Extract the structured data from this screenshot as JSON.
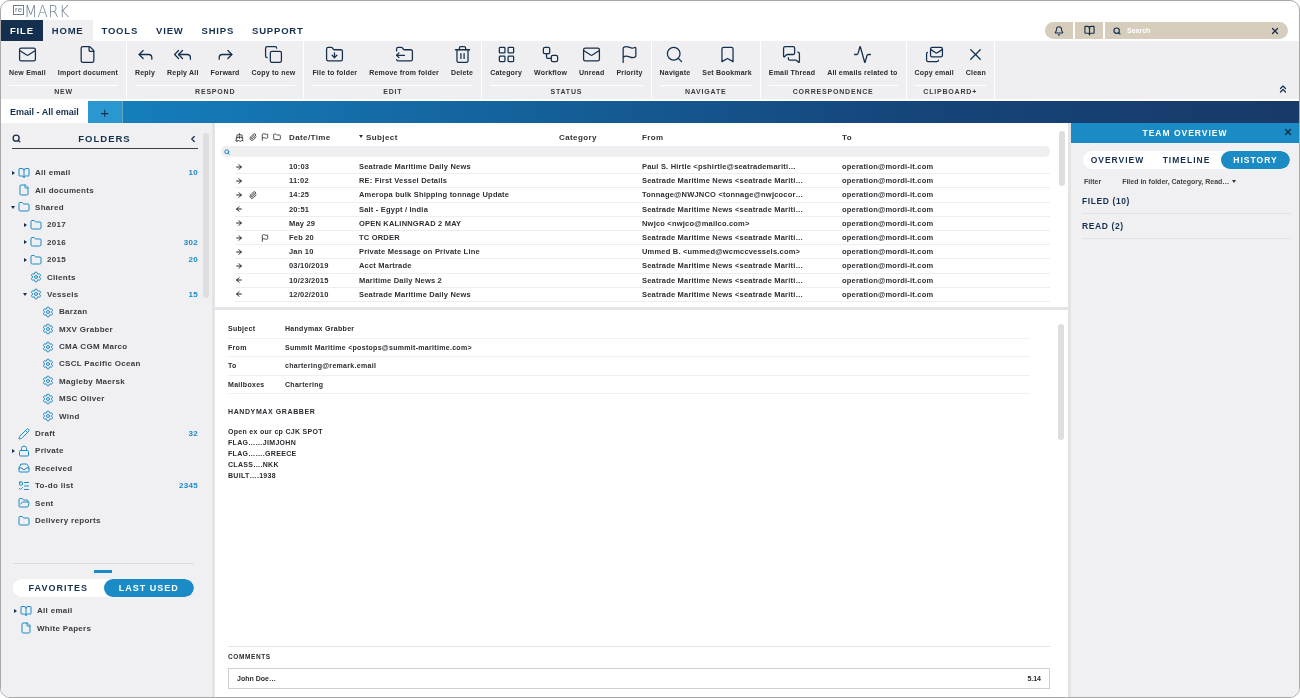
{
  "logo": {
    "prefix": "re",
    "name": "MARK"
  },
  "menu": [
    {
      "label": "FILE",
      "kind": "file",
      "selected": false
    },
    {
      "label": "HOME",
      "kind": "tab",
      "selected": true
    },
    {
      "label": "TOOLS",
      "kind": "tab",
      "selected": false
    },
    {
      "label": "VIEW",
      "kind": "tab",
      "selected": false
    },
    {
      "label": "SHIPS",
      "kind": "tab",
      "selected": false
    },
    {
      "label": "SUPPORT",
      "kind": "tab",
      "selected": false
    }
  ],
  "search": {
    "placeholder": "Search"
  },
  "ribbon": [
    {
      "group": "NEW",
      "buttons": [
        "New Email",
        "Import document"
      ]
    },
    {
      "group": "RESPOND",
      "buttons": [
        "Reply",
        "Reply All",
        "Forward",
        "Copy to new"
      ]
    },
    {
      "group": "EDIT",
      "buttons": [
        "File to folder",
        "Remove from folder",
        "Delete"
      ]
    },
    {
      "group": "STATUS",
      "buttons": [
        "Category",
        "Workflow",
        "Unread",
        "Priority"
      ]
    },
    {
      "group": "NAVIGATE",
      "buttons": [
        "Navigate",
        "Set Bookmark"
      ]
    },
    {
      "group": "CORRESPONDENCE",
      "buttons": [
        "Email Thread",
        "All emails related to"
      ]
    },
    {
      "group": "CLIPBOARD+",
      "buttons": [
        "Copy email",
        "Clean"
      ]
    }
  ],
  "doc_tabs": [
    {
      "label": "Email - All email",
      "selected": true
    }
  ],
  "add_tab": "+",
  "folders": {
    "title": "FOLDERS",
    "items": [
      {
        "label": "All email",
        "kind": "mailbox",
        "expanded": false,
        "count": "10"
      },
      {
        "label": "All documents",
        "kind": "document"
      },
      {
        "label": "Shared",
        "kind": "folder",
        "expanded": true,
        "children": [
          {
            "label": "2017",
            "kind": "folder",
            "expanded": false
          },
          {
            "label": "2016",
            "kind": "folder",
            "expanded": false,
            "count": "302"
          },
          {
            "label": "2015",
            "kind": "folder",
            "expanded": false,
            "count": "20"
          },
          {
            "label": "Clients",
            "kind": "vessel"
          },
          {
            "label": "Vessels",
            "kind": "vessel",
            "expanded": true,
            "count": "15",
            "children": [
              {
                "label": "Barzan",
                "kind": "vessel"
              },
              {
                "label": "MXV Grabber",
                "kind": "vessel"
              },
              {
                "label": "CMA CGM Marco",
                "kind": "vessel"
              },
              {
                "label": "CSCL Pacific Ocean",
                "kind": "vessel"
              },
              {
                "label": "Magleby Maersk",
                "kind": "vessel"
              },
              {
                "label": "MSC Oliver",
                "kind": "vessel"
              },
              {
                "label": "Wind",
                "kind": "vessel"
              }
            ]
          }
        ]
      },
      {
        "label": "Draft",
        "kind": "draft",
        "count": "32"
      },
      {
        "label": "Private",
        "kind": "private",
        "expanded": false
      },
      {
        "label": "Received",
        "kind": "received"
      },
      {
        "label": "To-do list",
        "kind": "todo",
        "count": "2345"
      },
      {
        "label": "Sent",
        "kind": "sent"
      },
      {
        "label": "Delivery reports",
        "kind": "folder"
      }
    ]
  },
  "favorites": {
    "tabs": [
      {
        "label": "FAVORITES",
        "selected": false
      },
      {
        "label": "LAST USED",
        "selected": true
      }
    ],
    "items": [
      {
        "label": "All email",
        "kind": "mailbox",
        "expanded": false
      },
      {
        "label": "White Papers",
        "kind": "document"
      }
    ]
  },
  "table": {
    "columns": [
      {
        "label": "Date/Time",
        "sorted": false
      },
      {
        "label": "Subject",
        "sorted": true
      },
      {
        "label": "Category",
        "sorted": false
      },
      {
        "label": "From",
        "sorted": false
      },
      {
        "label": "To",
        "sorted": false
      }
    ],
    "rows": [
      {
        "kind": "outgoing",
        "attachment": false,
        "flagged": false,
        "date": "10:03",
        "subject": "Seatrade Maritime Daily News",
        "from": "Paul S. Hirtle <pshirtle@seatrademariti…",
        "to": "operation@mordi-it.com"
      },
      {
        "kind": "outgoing",
        "attachment": false,
        "flagged": false,
        "date": "11:02",
        "subject": "RE: First Vessel Details",
        "from": "Seatrade Maritime News <seatrade Mariti…",
        "to": "operation@mordi-it.com"
      },
      {
        "kind": "outgoing",
        "attachment": true,
        "flagged": false,
        "date": "14:25",
        "subject": "Ameropa bulk Shipping tonnage Update",
        "from": "Tonnage@NWJNCO <tonnage@nwjcocor…",
        "to": "operation@mordi-it.com"
      },
      {
        "kind": "incoming",
        "attachment": false,
        "flagged": false,
        "date": "20:51",
        "subject": "Salt - Egypt / India",
        "from": "Seatrade Maritime News <seatrade Mariti…",
        "to": "operation@mordi-it.com"
      },
      {
        "kind": "outgoing",
        "attachment": false,
        "flagged": false,
        "date": "May 29",
        "subject": "OPEN KALINNGRAD 2 MAY",
        "from": "Nwjco <nwjco@mailco.com>",
        "to": "operation@mordi-it.com"
      },
      {
        "kind": "outgoing",
        "attachment": false,
        "flagged": true,
        "date": "Feb 20",
        "subject": "TC ORDER",
        "from": "Seatrade Maritime News <seatrade Mariti…",
        "to": "operation@mordi-it.com"
      },
      {
        "kind": "outgoing",
        "attachment": false,
        "flagged": false,
        "date": "Jan 10",
        "subject": "Private Message on Private Line",
        "from": "Ummed B. <ummed@wcmccvessels.com>",
        "to": "operation@mordi-it.com"
      },
      {
        "kind": "outgoing",
        "attachment": false,
        "flagged": false,
        "date": "03/10/2019",
        "subject": "Acct Martrade",
        "from": "Seatrade Maritime News <seatrade Mariti…",
        "to": "operation@mordi-it.com"
      },
      {
        "kind": "incoming",
        "attachment": false,
        "flagged": false,
        "date": "10/23/2015",
        "subject": "Maritime Daily News 2",
        "from": "Seatrade Maritime News <seatrade Mariti…",
        "to": "operation@mordi-it.com"
      },
      {
        "kind": "incoming",
        "attachment": false,
        "flagged": false,
        "date": "12/02/2010",
        "subject": "Seatrade Maritime Daily News",
        "from": "Seatrade Maritime News <seatrade Mariti…",
        "to": "operation@mordi-it.com"
      }
    ]
  },
  "preview": {
    "fields": [
      {
        "label": "Subject",
        "value": "Handymax Grabber"
      },
      {
        "label": "From",
        "value": "Summit Maritime <postops@summit-maritime.com>"
      },
      {
        "label": "To",
        "value": "chartering@remark.email"
      },
      {
        "label": "Mailboxes",
        "value": "Chartering"
      }
    ],
    "heading": "HANDYMAX GRABBER",
    "body": [
      "Open ex our cp CJK SPOT",
      "FLAG……JIMJOHN",
      "FLAG…….GREECE",
      "CLASS….NKK",
      "BUILT….1938"
    ],
    "comments_title": "COMMENTS",
    "comments": [
      {
        "author": "John Doe…",
        "time": "5.14"
      }
    ]
  },
  "team": {
    "title": "TEAM OVERVIEW",
    "tabs": [
      {
        "label": "OVERVIEW",
        "selected": false
      },
      {
        "label": "TIMELINE",
        "selected": false
      },
      {
        "label": "HISTORY",
        "selected": true
      }
    ],
    "filter_label": "Filter",
    "filter_value": "Filed in folder, Category, Read…",
    "sections": [
      "FILED (10)",
      "READ (2)"
    ]
  }
}
